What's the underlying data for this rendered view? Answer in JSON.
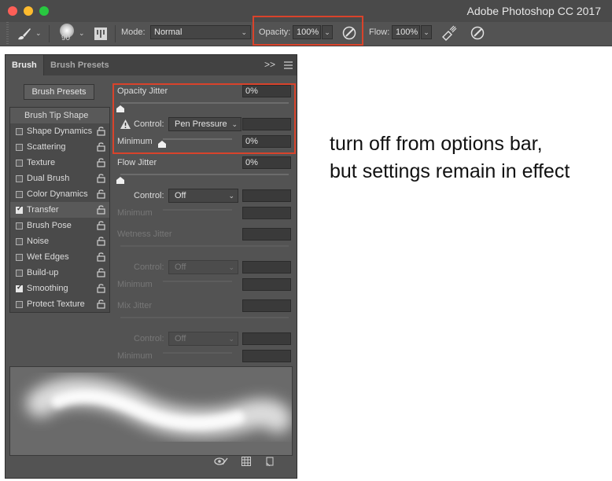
{
  "window": {
    "title": "Adobe Photoshop CC 2017"
  },
  "options_bar": {
    "brush_size": "90",
    "mode_label": "Mode:",
    "mode_value": "Normal",
    "opacity_label": "Opacity:",
    "opacity_value": "100%",
    "flow_label": "Flow:",
    "flow_value": "100%"
  },
  "panel": {
    "tabs": [
      {
        "label": "Brush",
        "active": true
      },
      {
        "label": "Brush Presets",
        "active": false
      }
    ],
    "brush_presets_button": "Brush Presets",
    "brush_tip_shape": "Brush Tip Shape",
    "items": [
      {
        "label": "Shape Dynamics",
        "checked": false
      },
      {
        "label": "Scattering",
        "checked": false
      },
      {
        "label": "Texture",
        "checked": false
      },
      {
        "label": "Dual Brush",
        "checked": false
      },
      {
        "label": "Color Dynamics",
        "checked": false
      },
      {
        "label": "Transfer",
        "checked": true
      },
      {
        "label": "Brush Pose",
        "checked": false
      },
      {
        "label": "Noise",
        "checked": false
      },
      {
        "label": "Wet Edges",
        "checked": false
      },
      {
        "label": "Build-up",
        "checked": false
      },
      {
        "label": "Smoothing",
        "checked": true
      },
      {
        "label": "Protect Texture",
        "checked": false
      }
    ],
    "transfer": {
      "opacity_jitter_label": "Opacity Jitter",
      "opacity_jitter_value": "0%",
      "control_label": "Control:",
      "opacity_control_value": "Pen Pressure",
      "minimum_label": "Minimum",
      "opacity_minimum_value": "0%",
      "flow_jitter_label": "Flow Jitter",
      "flow_jitter_value": "0%",
      "flow_control_value": "Off",
      "wetness_jitter_label": "Wetness Jitter",
      "wetness_control_value": "Off",
      "mix_jitter_label": "Mix Jitter",
      "mix_control_value": "Off"
    }
  },
  "annotation": {
    "line1": "turn off from options bar,",
    "line2": "but settings remain in effect"
  },
  "colors": {
    "highlight": "#d9432b",
    "panel_bg": "#535353",
    "title_bg": "#4a4a4a"
  }
}
